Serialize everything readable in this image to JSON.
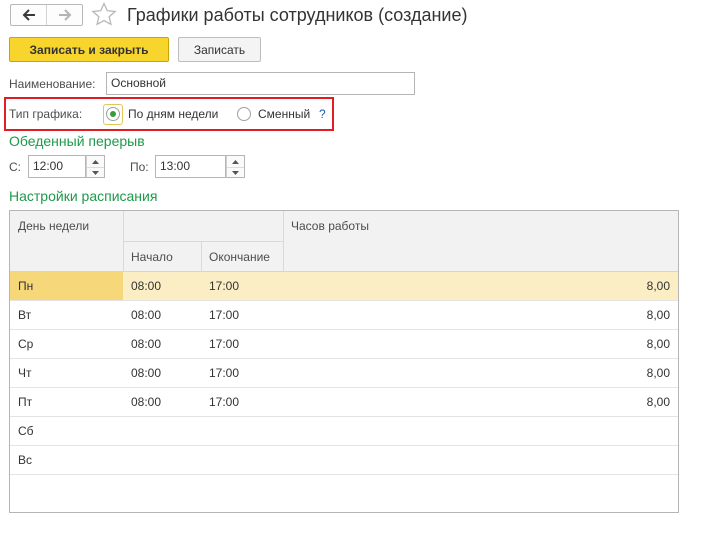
{
  "window": {
    "title": "Графики работы сотрудников (создание)"
  },
  "toolbar": {
    "save_close_label": "Записать и закрыть",
    "save_label": "Записать"
  },
  "form": {
    "name_label": "Наименование:",
    "name_value": "Основной",
    "schedule_type_label": "Тип графика:",
    "schedule_type_options": [
      {
        "label": "По дням недели",
        "selected": true
      },
      {
        "label": "Сменный",
        "selected": false
      }
    ],
    "help_label": "?"
  },
  "lunch_break": {
    "title": "Обеденный перерыв",
    "from_label": "С:",
    "from_value": "12:00",
    "to_label": "По:",
    "to_value": "13:00"
  },
  "schedule": {
    "title": "Настройки расписания",
    "columns": {
      "day": "День недели",
      "start": "Начало",
      "end": "Окончание",
      "hours": "Часов работы"
    },
    "rows": [
      {
        "day": "Пн",
        "start": "08:00",
        "end": "17:00",
        "hours": "8,00",
        "selected": true
      },
      {
        "day": "Вт",
        "start": "08:00",
        "end": "17:00",
        "hours": "8,00"
      },
      {
        "day": "Ср",
        "start": "08:00",
        "end": "17:00",
        "hours": "8,00"
      },
      {
        "day": "Чт",
        "start": "08:00",
        "end": "17:00",
        "hours": "8,00"
      },
      {
        "day": "Пт",
        "start": "08:00",
        "end": "17:00",
        "hours": "8,00"
      },
      {
        "day": "Сб",
        "start": "",
        "end": "",
        "hours": ""
      },
      {
        "day": "Вс",
        "start": "",
        "end": "",
        "hours": ""
      }
    ]
  },
  "icons": {
    "back": "arrow-left-icon",
    "forward": "arrow-right-icon",
    "favorite": "star-icon"
  },
  "colors": {
    "primary_button": "#f7d52c",
    "section_title": "#1d9a4a",
    "highlight_frame": "#e01c24",
    "selected_row": "#fbeec4"
  }
}
